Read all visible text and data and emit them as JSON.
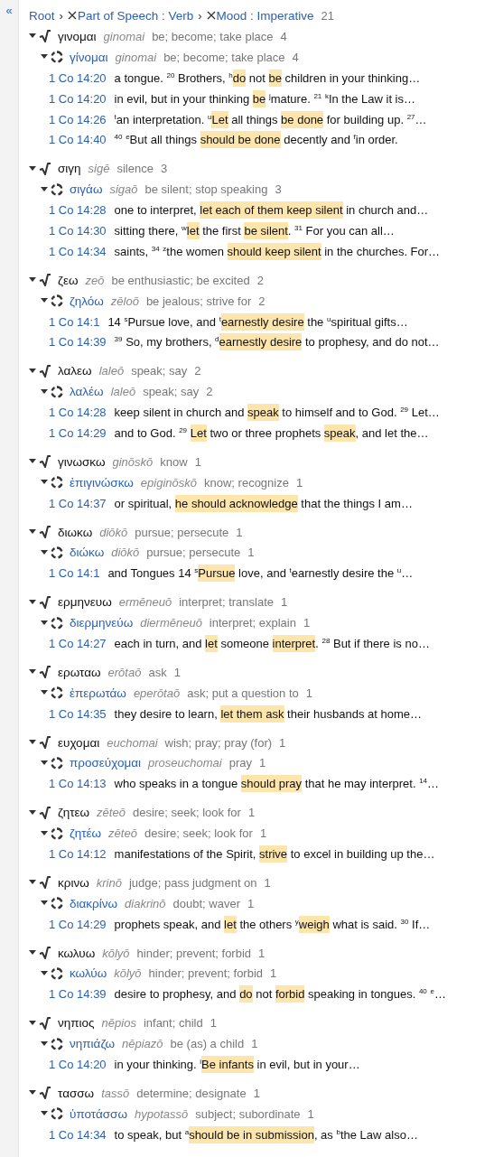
{
  "sidebar": {
    "collapse_label": "«"
  },
  "breadcrumb": {
    "items": [
      {
        "label": "Root",
        "removable": false
      },
      {
        "separator": "›",
        "label": "Part of Speech : Verb",
        "removable": true
      },
      {
        "separator": "›",
        "label": "Mood : Imperative",
        "removable": true
      }
    ],
    "count": "21"
  },
  "roots": [
    {
      "lemma": "γινομαι",
      "translit": "ginomai",
      "gloss": "be; become; take place",
      "count": "4",
      "expanded": true,
      "lemmas": [
        {
          "lemma": "γίνομαι",
          "translit": "ginomai",
          "gloss": "be; become; take place",
          "count": "4",
          "expanded": true,
          "hits": [
            {
              "ref": "1 Co 14:20",
              "parts": [
                {
                  "text": "a tongue. $^{20}$ Brothers, $^{h}$",
                  "highlight": false
                },
                {
                  "text": "do",
                  "highlight": true
                },
                {
                  "text": " not ",
                  "highlight": false
                },
                {
                  "text": "be",
                  "highlight": true
                },
                {
                  "text": " children in your thinking…",
                  "highlight": false
                }
              ]
            },
            {
              "ref": "1 Co 14:20",
              "parts": [
                {
                  "text": "in evil, but in your thinking ",
                  "highlight": false
                },
                {
                  "text": "be",
                  "highlight": true
                },
                {
                  "text": " $^{j}$mature. $^{21}$ $^{k}$In the Law it is…",
                  "highlight": false
                }
              ]
            },
            {
              "ref": "1 Co 14:26",
              "parts": [
                {
                  "text": "$^{t}$an interpretation. $^{u}$",
                  "highlight": false
                },
                {
                  "text": "Let",
                  "highlight": true
                },
                {
                  "text": " all things ",
                  "highlight": false
                },
                {
                  "text": "be done",
                  "highlight": true
                },
                {
                  "text": " for building up. $^{27}$…",
                  "highlight": false
                }
              ]
            },
            {
              "ref": "1 Co 14:40",
              "parts": [
                {
                  "text": "$^{40}$ $^{e}$But all things ",
                  "highlight": false
                },
                {
                  "text": "should be done",
                  "highlight": true
                },
                {
                  "text": " decently and $^{f}$in order.",
                  "highlight": false
                }
              ]
            }
          ]
        }
      ]
    },
    {
      "lemma": "σιγη",
      "translit": "sigē",
      "gloss": "silence",
      "count": "3",
      "expanded": true,
      "lemmas": [
        {
          "lemma": "σιγάω",
          "translit": "sigaō",
          "gloss": "be silent; stop speaking",
          "count": "3",
          "expanded": true,
          "hits": [
            {
              "ref": "1 Co 14:28",
              "parts": [
                {
                  "text": "one to interpret, ",
                  "highlight": false
                },
                {
                  "text": "let each of them keep silent",
                  "highlight": true
                },
                {
                  "text": " in church and…",
                  "highlight": false
                }
              ]
            },
            {
              "ref": "1 Co 14:30",
              "parts": [
                {
                  "text": "sitting there, $^{w}$",
                  "highlight": false
                },
                {
                  "text": "let",
                  "highlight": true
                },
                {
                  "text": " the first ",
                  "highlight": false
                },
                {
                  "text": "be silent",
                  "highlight": true
                },
                {
                  "text": ". $^{31}$ For you can all…",
                  "highlight": false
                }
              ]
            },
            {
              "ref": "1 Co 14:34",
              "parts": [
                {
                  "text": "saints, $^{34}$ $^{z}$the women ",
                  "highlight": false
                },
                {
                  "text": "should keep silent",
                  "highlight": true
                },
                {
                  "text": " in the churches. For…",
                  "highlight": false
                }
              ]
            }
          ]
        }
      ]
    },
    {
      "lemma": "ζεω",
      "translit": "zeō",
      "gloss": "be enthusiastic; be excited",
      "count": "2",
      "expanded": true,
      "lemmas": [
        {
          "lemma": "ζηλόω",
          "translit": "zēloō",
          "gloss": "be jealous; strive for",
          "count": "2",
          "expanded": true,
          "hits": [
            {
              "ref": "1 Co 14:1",
              "parts": [
                {
                  "text": "14 $^{s}$Pursue love, and $^{t}$",
                  "highlight": false
                },
                {
                  "text": "earnestly desire",
                  "highlight": true
                },
                {
                  "text": " the $^{u}$spiritual gifts…",
                  "highlight": false
                }
              ]
            },
            {
              "ref": "1 Co 14:39",
              "parts": [
                {
                  "text": "$^{39}$ So, my brothers, $^{d}$",
                  "highlight": false
                },
                {
                  "text": "earnestly desire",
                  "highlight": true
                },
                {
                  "text": " to prophesy, and do not…",
                  "highlight": false
                }
              ]
            }
          ]
        }
      ]
    },
    {
      "lemma": "λαλεω",
      "translit": "laleō",
      "gloss": "speak; say",
      "count": "2",
      "expanded": true,
      "lemmas": [
        {
          "lemma": "λαλέω",
          "translit": "laleō",
          "gloss": "speak; say",
          "count": "2",
          "expanded": true,
          "hits": [
            {
              "ref": "1 Co 14:28",
              "parts": [
                {
                  "text": "keep silent in church and ",
                  "highlight": false
                },
                {
                  "text": "speak",
                  "highlight": true
                },
                {
                  "text": " to himself and to God. $^{29}$ Let…",
                  "highlight": false
                }
              ]
            },
            {
              "ref": "1 Co 14:29",
              "parts": [
                {
                  "text": "and to God. $^{29}$ ",
                  "highlight": false
                },
                {
                  "text": "Let",
                  "highlight": true
                },
                {
                  "text": " two or three prophets ",
                  "highlight": false
                },
                {
                  "text": "speak",
                  "highlight": true
                },
                {
                  "text": ", and let the…",
                  "highlight": false
                }
              ]
            }
          ]
        }
      ]
    },
    {
      "lemma": "γινωσκω",
      "translit": "ginōskō",
      "gloss": "know",
      "count": "1",
      "expanded": true,
      "lemmas": [
        {
          "lemma": "ἐπιγινώσκω",
          "translit": "epiginōskō",
          "gloss": "know; recognize",
          "count": "1",
          "expanded": true,
          "hits": [
            {
              "ref": "1 Co 14:37",
              "parts": [
                {
                  "text": "or spiritual, ",
                  "highlight": false
                },
                {
                  "text": "he should acknowledge",
                  "highlight": true
                },
                {
                  "text": " that the things I am…",
                  "highlight": false
                }
              ]
            }
          ]
        }
      ]
    },
    {
      "lemma": "διωκω",
      "translit": "diōkō",
      "gloss": "pursue; persecute",
      "count": "1",
      "expanded": true,
      "lemmas": [
        {
          "lemma": "διώκω",
          "translit": "diōkō",
          "gloss": "pursue; persecute",
          "count": "1",
          "expanded": true,
          "hits": [
            {
              "ref": "1 Co 14:1",
              "parts": [
                {
                  "text": "and Tongues 14 $^{s}$",
                  "highlight": false
                },
                {
                  "text": "Pursue",
                  "highlight": true
                },
                {
                  "text": " love, and $^{t}$earnestly desire the $^{u}$…",
                  "highlight": false
                }
              ]
            }
          ]
        }
      ]
    },
    {
      "lemma": "ερμηνευω",
      "translit": "ermēneuō",
      "gloss": "interpret; translate",
      "count": "1",
      "expanded": true,
      "lemmas": [
        {
          "lemma": "διερμηνεύω",
          "translit": "diermēneuō",
          "gloss": "interpret; explain",
          "count": "1",
          "expanded": true,
          "hits": [
            {
              "ref": "1 Co 14:27",
              "parts": [
                {
                  "text": "each in turn, and ",
                  "highlight": false
                },
                {
                  "text": "let",
                  "highlight": true
                },
                {
                  "text": " someone ",
                  "highlight": false
                },
                {
                  "text": "interpret",
                  "highlight": true
                },
                {
                  "text": ". $^{28}$ But if there is no…",
                  "highlight": false
                }
              ]
            }
          ]
        }
      ]
    },
    {
      "lemma": "ερωταω",
      "translit": "erōtaō",
      "gloss": "ask",
      "count": "1",
      "expanded": true,
      "lemmas": [
        {
          "lemma": "ἐπερωτάω",
          "translit": "eperōtaō",
          "gloss": "ask; put a question to",
          "count": "1",
          "expanded": true,
          "hits": [
            {
              "ref": "1 Co 14:35",
              "parts": [
                {
                  "text": "they desire to learn, ",
                  "highlight": false
                },
                {
                  "text": "let them ask",
                  "highlight": true
                },
                {
                  "text": " their husbands at home…",
                  "highlight": false
                }
              ]
            }
          ]
        }
      ]
    },
    {
      "lemma": "ευχομαι",
      "translit": "euchomai",
      "gloss": "wish; pray; pray (for)",
      "count": "1",
      "expanded": true,
      "lemmas": [
        {
          "lemma": "προσεύχομαι",
          "translit": "proseuchomai",
          "gloss": "pray",
          "count": "1",
          "expanded": true,
          "hits": [
            {
              "ref": "1 Co 14:13",
              "parts": [
                {
                  "text": "who speaks in a tongue ",
                  "highlight": false
                },
                {
                  "text": "should pray",
                  "highlight": true
                },
                {
                  "text": " that he may interpret. $^{14}$…",
                  "highlight": false
                }
              ]
            }
          ]
        }
      ]
    },
    {
      "lemma": "ζητεω",
      "translit": "zēteō",
      "gloss": "desire; seek; look for",
      "count": "1",
      "expanded": true,
      "lemmas": [
        {
          "lemma": "ζητέω",
          "translit": "zēteō",
          "gloss": "desire; seek; look for",
          "count": "1",
          "expanded": true,
          "hits": [
            {
              "ref": "1 Co 14:12",
              "parts": [
                {
                  "text": "manifestations of the Spirit, ",
                  "highlight": false
                },
                {
                  "text": "strive",
                  "highlight": true
                },
                {
                  "text": " to excel in building up the…",
                  "highlight": false
                }
              ]
            }
          ]
        }
      ]
    },
    {
      "lemma": "κρινω",
      "translit": "krinō",
      "gloss": "judge; pass judgment on",
      "count": "1",
      "expanded": true,
      "lemmas": [
        {
          "lemma": "διακρίνω",
          "translit": "diakrinō",
          "gloss": "doubt; waver",
          "count": "1",
          "expanded": true,
          "hits": [
            {
              "ref": "1 Co 14:29",
              "parts": [
                {
                  "text": "prophets speak, and ",
                  "highlight": false
                },
                {
                  "text": "let",
                  "highlight": true
                },
                {
                  "text": " the others $^{y}$",
                  "highlight": false
                },
                {
                  "text": "weigh",
                  "highlight": true
                },
                {
                  "text": " what is said. $^{30}$ If…",
                  "highlight": false
                }
              ]
            }
          ]
        }
      ]
    },
    {
      "lemma": "κωλυω",
      "translit": "kōlyō",
      "gloss": "hinder; prevent; forbid",
      "count": "1",
      "expanded": true,
      "lemmas": [
        {
          "lemma": "κωλύω",
          "translit": "kōlyō",
          "gloss": "hinder; prevent; forbid",
          "count": "1",
          "expanded": true,
          "hits": [
            {
              "ref": "1 Co 14:39",
              "parts": [
                {
                  "text": "desire to prophesy, and ",
                  "highlight": false
                },
                {
                  "text": "do",
                  "highlight": true
                },
                {
                  "text": " not ",
                  "highlight": false
                },
                {
                  "text": "forbid",
                  "highlight": true
                },
                {
                  "text": " speaking in tongues. $^{40}$ $^{e}$…",
                  "highlight": false
                }
              ]
            }
          ]
        }
      ]
    },
    {
      "lemma": "νηπιος",
      "translit": "nēpios",
      "gloss": "infant; child",
      "count": "1",
      "expanded": true,
      "lemmas": [
        {
          "lemma": "νηπιάζω",
          "translit": "nēpiazō",
          "gloss": "be (as) a child",
          "count": "1",
          "expanded": true,
          "hits": [
            {
              "ref": "1 Co 14:20",
              "parts": [
                {
                  "text": "in your thinking. $^{i}$",
                  "highlight": false
                },
                {
                  "text": "Be infants",
                  "highlight": true
                },
                {
                  "text": " in evil, but in your…",
                  "highlight": false
                }
              ]
            }
          ]
        }
      ]
    },
    {
      "lemma": "τασσω",
      "translit": "tassō",
      "gloss": "determine; designate",
      "count": "1",
      "expanded": true,
      "lemmas": [
        {
          "lemma": "ὑποτάσσω",
          "translit": "hypotassō",
          "gloss": "subject; subordinate",
          "count": "1",
          "expanded": true,
          "hits": [
            {
              "ref": "1 Co 14:34",
              "parts": [
                {
                  "text": "to speak, but $^{a}$",
                  "highlight": false
                },
                {
                  "text": "should be in submission",
                  "highlight": true
                },
                {
                  "text": ", as $^{b}$the Law also…",
                  "highlight": false
                }
              ]
            }
          ]
        }
      ]
    }
  ]
}
